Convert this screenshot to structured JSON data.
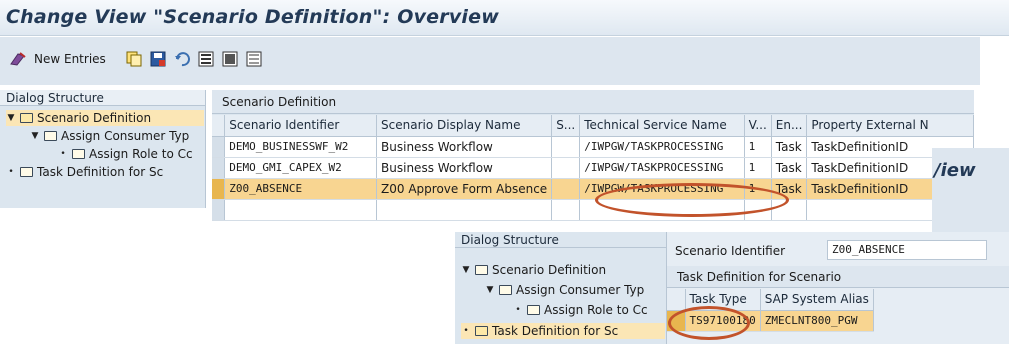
{
  "title": "Change View \"Scenario Definition\": Overview",
  "toolbar": {
    "new_entries_label": "New Entries",
    "icons": [
      "new-entries-icon",
      "copy-icon",
      "save-icon",
      "undo-icon",
      "select-all-icon",
      "select-block-icon",
      "deselect-icon"
    ]
  },
  "dialog_structure": {
    "heading": "Dialog Structure",
    "items": [
      {
        "label": "Scenario Definition",
        "level": 0,
        "expanded": true,
        "selected": true,
        "icon": "folder-open-icon"
      },
      {
        "label": "Assign Consumer Typ",
        "level": 1,
        "expanded": true,
        "selected": false,
        "icon": "folder-icon"
      },
      {
        "label": "Assign Role to Cc",
        "level": 2,
        "expanded": false,
        "selected": false,
        "icon": "folder-icon"
      },
      {
        "label": "Task Definition for Sc",
        "level": 0,
        "expanded": false,
        "selected": false,
        "icon": "folder-icon"
      }
    ]
  },
  "scenario_table": {
    "caption": "Scenario Definition",
    "columns": [
      "Scenario Identifier",
      "Scenario Display Name",
      "S...",
      "Technical Service Name",
      "V...",
      "En...",
      "Property External N"
    ],
    "rows": [
      {
        "identifier": "DEMO_BUSINESSWF_W2",
        "display_name": "Business Workflow",
        "s": "",
        "service": "/IWPGW/TASKPROCESSING",
        "v": "1",
        "en": "Task",
        "property": "TaskDefinitionID",
        "selected": false
      },
      {
        "identifier": "DEMO_GMI_CAPEX_W2",
        "display_name": "Business Workflow",
        "s": "",
        "service": "/IWPGW/TASKPROCESSING",
        "v": "1",
        "en": "Task",
        "property": "TaskDefinitionID",
        "selected": false
      },
      {
        "identifier": "Z00_ABSENCE",
        "display_name": "Z00 Approve Form Absence",
        "s": "",
        "service": "/IWPGW/TASKPROCESSING",
        "v": "1",
        "en": "Task",
        "property": "TaskDefinitionID",
        "selected": true
      }
    ]
  },
  "overlay": {
    "behind_title_fragment": "/iew",
    "dialog_structure": {
      "heading": "Dialog Structure",
      "items": [
        {
          "label": "Scenario Definition",
          "level": 0,
          "expanded": true,
          "selected": false,
          "icon": "folder-icon"
        },
        {
          "label": "Assign Consumer Typ",
          "level": 1,
          "expanded": true,
          "selected": false,
          "icon": "folder-icon"
        },
        {
          "label": "Assign Role to Cc",
          "level": 2,
          "expanded": false,
          "selected": false,
          "icon": "folder-icon"
        },
        {
          "label": "Task Definition for Sc",
          "level": 0,
          "expanded": false,
          "selected": true,
          "icon": "folder-open-icon"
        }
      ]
    },
    "scenario_identifier_label": "Scenario Identifier",
    "scenario_identifier_value": "Z00_ABSENCE",
    "task_table": {
      "caption": "Task Definition for Scenario",
      "columns": [
        "Task Type",
        "SAP System Alias"
      ],
      "rows": [
        {
          "task_type": "TS97100180",
          "alias": "ZMECLNT800_PGW",
          "selected": true
        }
      ]
    }
  },
  "annotation_color": "#c2532b",
  "selection_color": "#f8d591"
}
